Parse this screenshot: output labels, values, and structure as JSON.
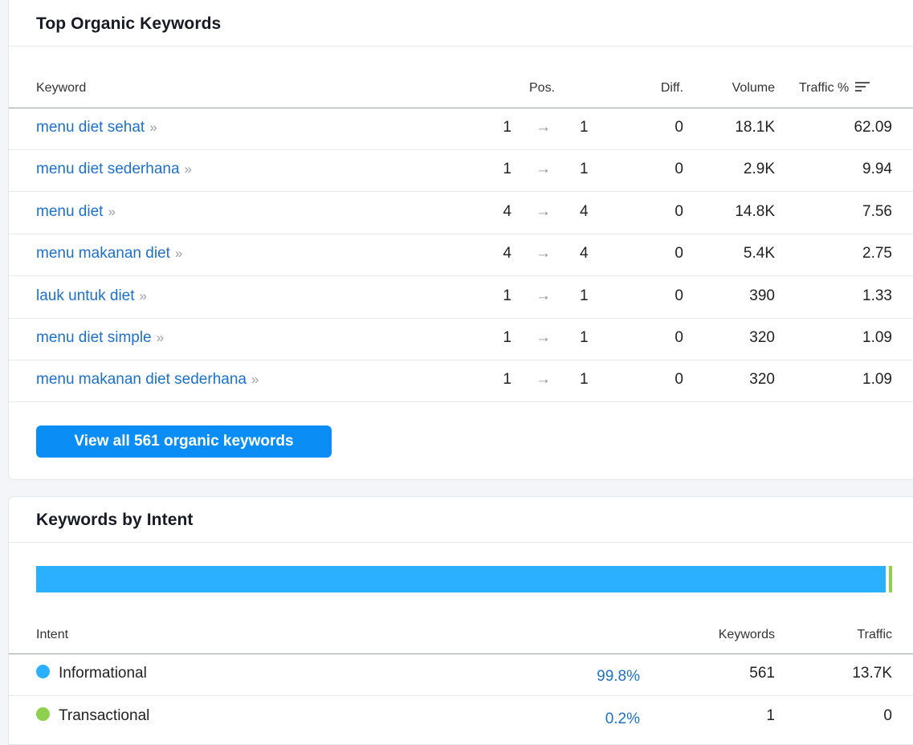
{
  "top_keywords": {
    "title": "Top Organic Keywords",
    "columns": {
      "keyword": "Keyword",
      "pos": "Pos.",
      "diff": "Diff.",
      "volume": "Volume",
      "traffic": "Traffic %"
    },
    "sort_icon": "sort-descending-icon",
    "rows": [
      {
        "keyword": "menu diet sehat",
        "pos_from": "1",
        "pos_to": "1",
        "diff": "0",
        "volume": "18.1K",
        "traffic": "62.09"
      },
      {
        "keyword": "menu diet sederhana",
        "pos_from": "1",
        "pos_to": "1",
        "diff": "0",
        "volume": "2.9K",
        "traffic": "9.94"
      },
      {
        "keyword": "menu diet",
        "pos_from": "4",
        "pos_to": "4",
        "diff": "0",
        "volume": "14.8K",
        "traffic": "7.56"
      },
      {
        "keyword": "menu makanan diet",
        "pos_from": "4",
        "pos_to": "4",
        "diff": "0",
        "volume": "5.4K",
        "traffic": "2.75"
      },
      {
        "keyword": "lauk untuk diet",
        "pos_from": "1",
        "pos_to": "1",
        "diff": "0",
        "volume": "390",
        "traffic": "1.33"
      },
      {
        "keyword": "menu diet simple",
        "pos_from": "1",
        "pos_to": "1",
        "diff": "0",
        "volume": "320",
        "traffic": "1.09"
      },
      {
        "keyword": "menu makanan diet sederhana",
        "pos_from": "1",
        "pos_to": "1",
        "diff": "0",
        "volume": "320",
        "traffic": "1.09"
      }
    ],
    "arrow_glyph": "→",
    "chevron_glyph": "»",
    "view_all_label": "View all 561 organic keywords",
    "accent_color": "#0a8ef5",
    "link_color": "#1e70c8"
  },
  "intent": {
    "title": "Keywords by Intent",
    "columns": {
      "intent": "Intent",
      "keywords": "Keywords",
      "traffic": "Traffic"
    },
    "rows": [
      {
        "name": "Informational",
        "share": "99.8%",
        "keywords": "561",
        "traffic": "13.7K",
        "color": "#2bb0ff",
        "fraction": 0.998
      },
      {
        "name": "Transactional",
        "share": "0.2%",
        "keywords": "1",
        "traffic": "0",
        "color": "#8fd14f",
        "fraction": 0.002
      }
    ]
  }
}
